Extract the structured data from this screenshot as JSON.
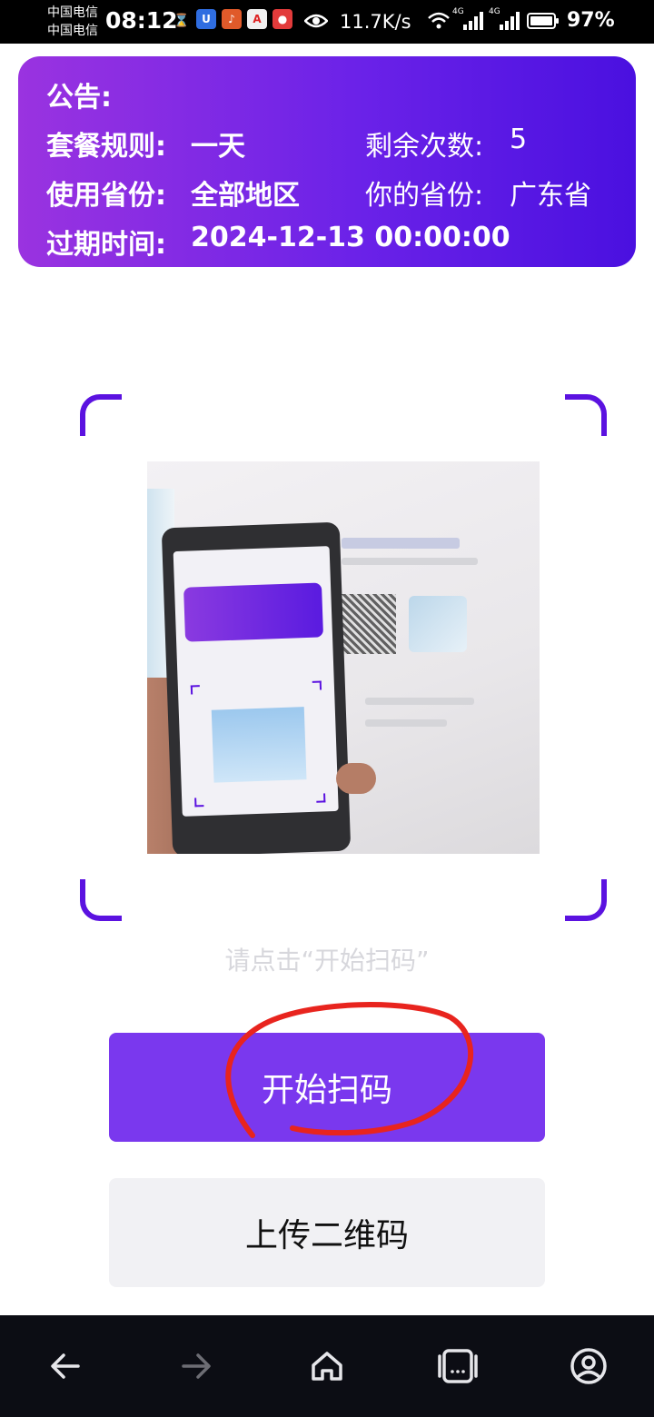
{
  "status_bar": {
    "carrier_1": "中国电信",
    "carrier_2": "中国电信",
    "time": "08:12",
    "net_speed": "11.7K/s",
    "network_1": "4G",
    "network_2": "4G",
    "battery": "97%",
    "icons": [
      "hourglass-icon",
      "app-u-icon",
      "app-ting-icon",
      "app-a-icon",
      "app-red-icon",
      "eye-icon",
      "wifi-icon",
      "signal-icon",
      "battery-icon"
    ]
  },
  "notice": {
    "title": "公告:",
    "rule_label": "套餐规则:",
    "rule_value": "一天",
    "remaining_label": "剩余次数:",
    "remaining_value": "5",
    "province_use_label": "使用省份:",
    "province_use_value": "全部地区",
    "your_province_label": "你的省份:",
    "your_province_value": "广东省",
    "expire_label": "过期时间:",
    "expire_value": "2024-12-13 00:00:00"
  },
  "scanner": {
    "hint": "请点击“开始扫码”"
  },
  "buttons": {
    "start_scan": "开始扫码",
    "upload_qr": "上传二维码"
  },
  "colors": {
    "accent": "#7a38ee",
    "corner": "#5b12e0",
    "annotation": "#e8241e"
  },
  "bottom_nav": [
    "back-icon",
    "forward-icon",
    "home-icon",
    "tabs-icon",
    "account-icon"
  ]
}
